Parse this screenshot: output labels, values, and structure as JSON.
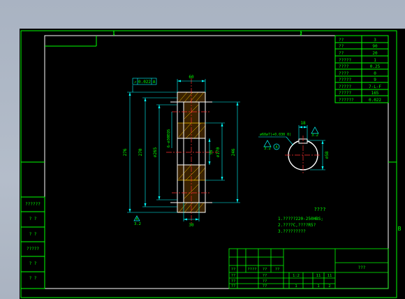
{
  "colors": {
    "background": "#a9b3c2",
    "canvas": "#000000",
    "frame_line": "#ffffff",
    "border_line": "#00ff00",
    "dimension": "#00ffff",
    "centerline": "#ff3030",
    "part_outline": "#ffffff",
    "hatch": "#ffcc00",
    "text": "#00ff00"
  },
  "frame": {
    "zone_top_1": "1",
    "zone_top_2": "2",
    "zone_right_b": "B"
  },
  "param_table": {
    "rows": [
      {
        "label": "??",
        "value": "3"
      },
      {
        "label": "??",
        "value": "90"
      },
      {
        "label": "??",
        "value": "20"
      },
      {
        "label": "?????",
        "value": "1"
      },
      {
        "label": "????",
        "value": "0.25"
      },
      {
        "label": "????",
        "value": "0"
      },
      {
        "label": "?????",
        "value": "9"
      },
      {
        "label": "?????",
        "value": "7-L-F"
      },
      {
        "label": "?????",
        "value": "165"
      },
      {
        "label": "??????",
        "value": "0.022"
      }
    ]
  },
  "left_labels": [
    "??????",
    "? ?",
    "? ?",
    "?????",
    "? ?",
    "? ?"
  ],
  "gear_view": {
    "tolerance_frame": {
      "symbol": "↗",
      "value": "0.022",
      "datum": "A"
    },
    "dims": {
      "top_width": "60",
      "bottom_width": "30",
      "outer_dia": "276",
      "tip_dia": "270",
      "pitch_dia": "⌀265",
      "bore_spec": "6-⌀30EQS",
      "hub_dia": "⌀170",
      "root_dia": "246",
      "hub_inner": "58"
    },
    "datum_label": "A",
    "roughness": "3.2"
  },
  "hub_view": {
    "keyway_width": "18",
    "bore_dia": "⌀58",
    "roughness_note": "⌀60⌀7(+0.030 0)",
    "roughness_value": "3.2",
    "datum_label": "A",
    "roughness_small": "3.2"
  },
  "notes": {
    "title": "????",
    "lines": [
      "1.?????220-250HBS;",
      "2.????C,????R5?",
      "3.?????????"
    ]
  },
  "title_block": {
    "part_name": "???",
    "cells": {
      "r3": [
        "??",
        "????",
        "??",
        "??"
      ],
      "r4": [
        "??",
        "",
        "??"
      ],
      "r5": [
        "??",
        "??"
      ],
      "r6": [
        "??",
        "??"
      ],
      "scale": "1:2",
      "sheet_a": "1",
      "sheet_b": "1",
      "c_1": "1:2",
      "c_2": "11",
      "c_3": "11",
      "c_4": "1",
      "c_5": "1",
      "c_6": "2"
    }
  }
}
